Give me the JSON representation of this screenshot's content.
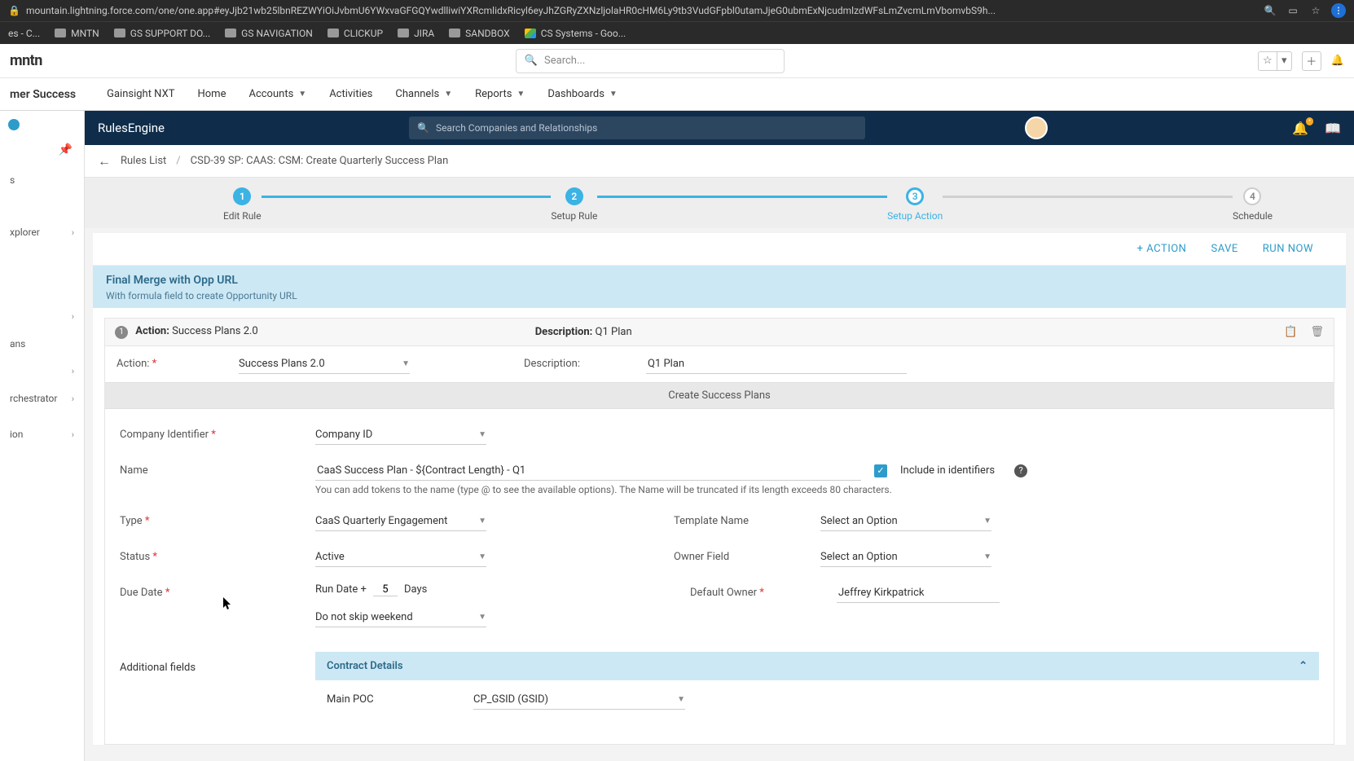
{
  "browser": {
    "url": "mountain.lightning.force.com/one/one.app#eyJjb21wb25lbnREZWYiOiJvbmU6YWxvaGFGQYwdlliwiYXRcmlidxRicyl6eyJhZGRyZXNzljolaHR0cHM6Ly9tb3VudGFpbl0utamJjeG0ubmExNjcudmlzdWFsLmZvcmLmVbomvbS9h...",
    "bookmarks": [
      "es - C...",
      "MNTN",
      "GS SUPPORT DO...",
      "GS NAVIGATION",
      "CLICKUP",
      "JIRA",
      "SANDBOX",
      "CS Systems - Goo..."
    ]
  },
  "salesforce": {
    "logo": "mntn",
    "search_placeholder": "Search...",
    "app_label": "mer Success",
    "nav": [
      "Gainsight NXT",
      "Home",
      "Accounts",
      "Activities",
      "Channels",
      "Reports",
      "Dashboards"
    ],
    "nav_has_chevron": [
      false,
      false,
      true,
      false,
      true,
      true,
      true
    ]
  },
  "gs_sidebar": {
    "items": [
      "s",
      "xplorer",
      "",
      "ans",
      "",
      "rchestrator",
      "ion"
    ]
  },
  "gs_header": {
    "title": "RulesEngine",
    "search_placeholder": "Search Companies and Relationships"
  },
  "breadcrumb": {
    "rules_list": "Rules List",
    "current": "CSD-39 SP: CAAS: CSM: Create Quarterly Success Plan"
  },
  "stepper": {
    "steps": [
      "Edit Rule",
      "Setup Rule",
      "Setup Action",
      "Schedule"
    ]
  },
  "action_bar": {
    "add": "+ ACTION",
    "save": "SAVE",
    "run": "RUN NOW"
  },
  "card": {
    "title": "Final Merge with Opp URL",
    "subtitle": "With formula field to create Opportunity URL"
  },
  "action_block": {
    "num": "1",
    "action_label": "Action:",
    "action_value": "Success Plans 2.0",
    "desc_label": "Description:",
    "desc_value": "Q1 Plan",
    "row_action_lab": "Action: ",
    "row_action_val": "Success Plans 2.0",
    "row_desc_lab": "Description:",
    "row_desc_val": "Q1 Plan",
    "section_title": "Create Success Plans"
  },
  "form": {
    "company_id_lab": "Company Identifier",
    "company_id_val": "Company ID",
    "name_lab": "Name",
    "name_val": "CaaS Success Plan - ${Contract Length} - Q1",
    "name_hint": "You can add tokens to the name (type @ to see the available options). The Name will be truncated if its length exceeds 80 characters.",
    "include_lab": "Include in identifiers",
    "type_lab": "Type",
    "type_val": "CaaS Quarterly Engagement",
    "template_lab": "Template Name",
    "template_val": "Select an Option",
    "status_lab": "Status",
    "status_val": "Active",
    "owner_lab": "Owner Field",
    "owner_val": "Select an Option",
    "due_lab": "Due Date",
    "due_prefix": "Run Date +",
    "due_days_val": "5",
    "due_suffix": "Days",
    "default_owner_lab": "Default Owner",
    "default_owner_val": "Jeffrey Kirkpatrick",
    "skip_val": "Do not skip weekend",
    "additional_lab": "Additional fields",
    "contract_header": "Contract Details",
    "main_poc_lab": "Main POC",
    "main_poc_val": "CP_GSID (GSID)"
  }
}
